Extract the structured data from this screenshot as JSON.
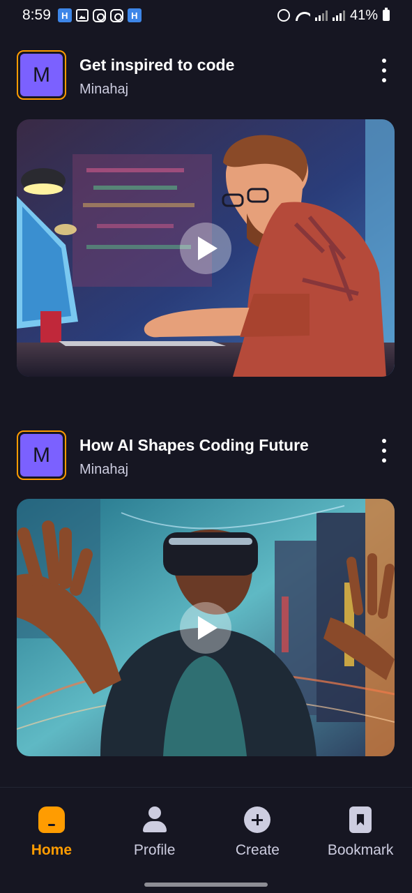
{
  "status_bar": {
    "time": "8:59",
    "battery": "41%",
    "left_icons": [
      "h-app-icon",
      "gallery-icon",
      "instagram-icon",
      "instagram-icon",
      "h-app-icon"
    ],
    "right_icons": [
      "alarm-icon",
      "wifi-icon",
      "signal-icon",
      "signal-icon",
      "battery-icon"
    ]
  },
  "colors": {
    "background": "#161622",
    "accent": "#ff9c01",
    "avatar": "#7b61ff",
    "muted_text": "#cdcde0"
  },
  "posts": [
    {
      "avatar_letter": "M",
      "title": "Get inspired to code",
      "author": "Minahaj",
      "thumbnail": "man-coding-at-laptop-illustration",
      "has_play_button": true
    },
    {
      "avatar_letter": "M",
      "title": "How AI Shapes Coding Future",
      "author": "Minahaj",
      "thumbnail": "man-wearing-vr-headset-in-city",
      "has_play_button": true
    }
  ],
  "tabs": [
    {
      "label": "Home",
      "icon": "home-icon",
      "active": true
    },
    {
      "label": "Profile",
      "icon": "profile-icon",
      "active": false
    },
    {
      "label": "Create",
      "icon": "plus-circle-icon",
      "active": false
    },
    {
      "label": "Bookmark",
      "icon": "bookmark-icon",
      "active": false
    }
  ]
}
